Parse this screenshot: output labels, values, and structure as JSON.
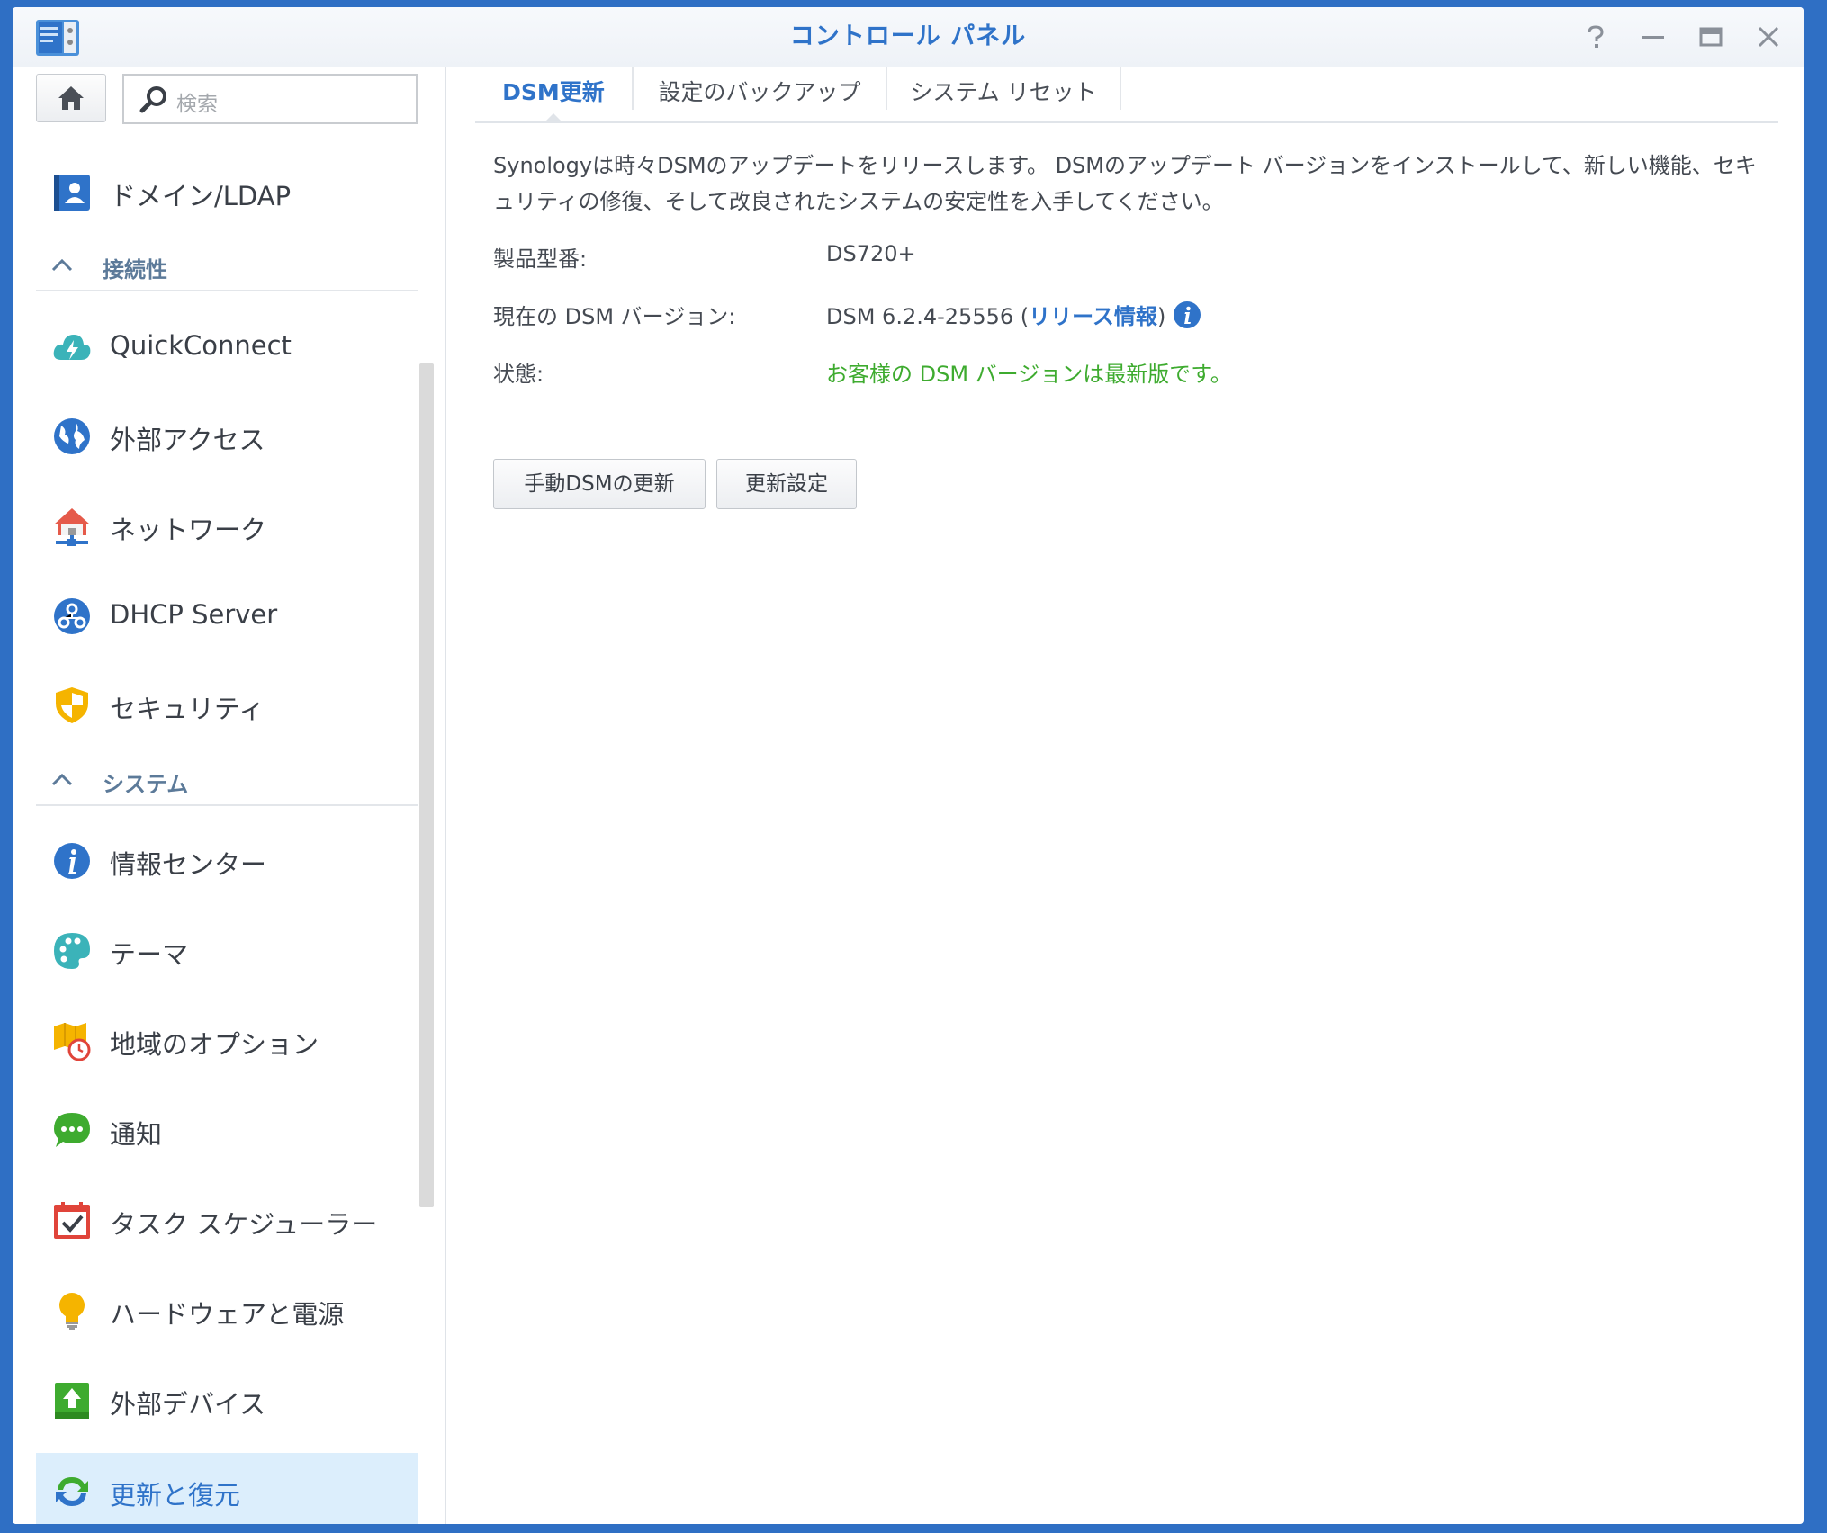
{
  "window": {
    "title": "コントロール パネル",
    "controls": {
      "help": "help-icon",
      "minimize": "minimize-icon",
      "maximize": "maximize-icon",
      "close": "close-icon"
    }
  },
  "sidebar": {
    "search_placeholder": "検索",
    "items": [
      {
        "label": "ドメイン/LDAP",
        "icon": "domain-ldap-icon"
      },
      {
        "label": "QuickConnect",
        "icon": "quickconnect-icon"
      },
      {
        "label": "外部アクセス",
        "icon": "external-access-icon"
      },
      {
        "label": "ネットワーク",
        "icon": "network-icon"
      },
      {
        "label": "DHCP Server",
        "icon": "dhcp-server-icon"
      },
      {
        "label": "セキュリティ",
        "icon": "security-icon"
      },
      {
        "label": "情報センター",
        "icon": "info-center-icon"
      },
      {
        "label": "テーマ",
        "icon": "theme-icon"
      },
      {
        "label": "地域のオプション",
        "icon": "regional-options-icon"
      },
      {
        "label": "通知",
        "icon": "notification-icon"
      },
      {
        "label": "タスク スケジューラー",
        "icon": "task-scheduler-icon"
      },
      {
        "label": "ハードウェアと電源",
        "icon": "hardware-power-icon"
      },
      {
        "label": "外部デバイス",
        "icon": "external-devices-icon"
      },
      {
        "label": "更新と復元",
        "icon": "update-restore-icon",
        "active": true
      }
    ],
    "sections": {
      "connectivity": "接続性",
      "system": "システム"
    }
  },
  "tabs": [
    {
      "label": "DSM更新",
      "active": true
    },
    {
      "label": "設定のバックアップ"
    },
    {
      "label": "システム リセット"
    }
  ],
  "content": {
    "description": "Synologyは時々DSMのアップデートをリリースします。 DSMのアップデート バージョンをインストールして、新しい機能、セキュリティの修復、そして改良されたシステムの安定性を入手してください。",
    "model_label": "製品型番:",
    "model_value": "DS720+",
    "version_label": "現在の DSM バージョン:",
    "version_value": "DSM 6.2.4-25556",
    "version_paren_open": " (",
    "release_notes_link": "リリース情報",
    "version_paren_close": ")",
    "status_label": "状態:",
    "status_value": "お客様の DSM バージョンは最新版です。",
    "manual_update_button": "手動DSMの更新",
    "update_settings_button": "更新設定"
  },
  "colors": {
    "accent": "#2f73c9",
    "status_ok": "#3eab2f",
    "desktop_bg": "#2f6fc4",
    "active_item_bg": "#dceefc"
  }
}
